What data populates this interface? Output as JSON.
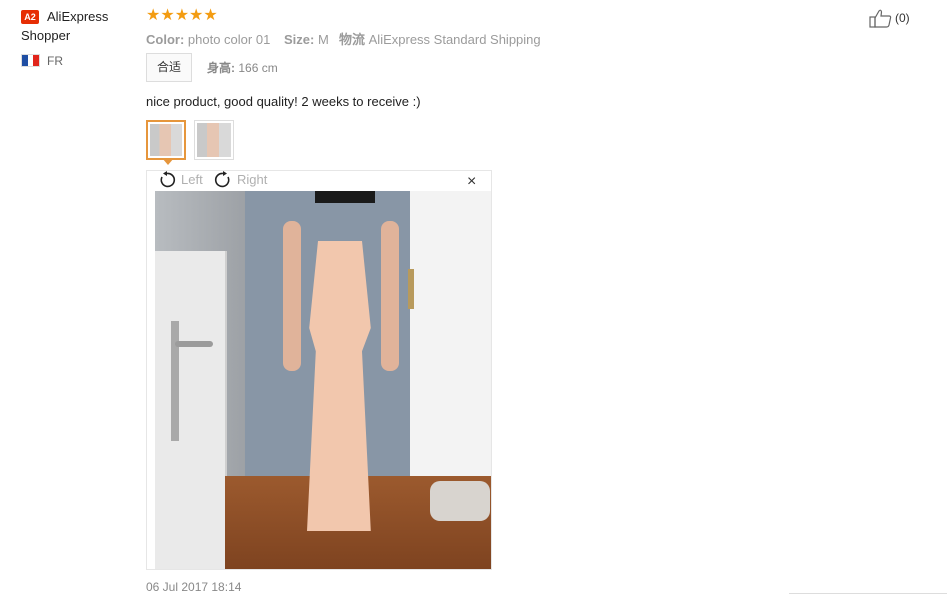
{
  "review": {
    "badge": "A2",
    "username_line1": "AliExpress",
    "username_line2": "Shopper",
    "country_code": "FR",
    "flag_colors": [
      "#1f4ea3",
      "#ffffff",
      "#e1251b"
    ],
    "rating_stars": 5,
    "stars_text": "★★★★★",
    "attributes": {
      "color_label": "Color:",
      "color_value": "photo color 01",
      "size_label": "Size:",
      "size_value": "M",
      "shipping_label": "物流",
      "shipping_value": "AliExpress Standard Shipping"
    },
    "fit_tag": "合适",
    "height_label": "身高:",
    "height_value": "166 cm",
    "feedback_text": "nice product, good quality! 2 weeks to receive :)",
    "thumbnail_count": 2,
    "viewer": {
      "rotate_left": "Left",
      "rotate_right": "Right",
      "close": "×"
    },
    "date": "06 Jul 2017 18:14",
    "helpful_count": "(0)"
  },
  "colors": {
    "star": "#f39c12",
    "badge": "#e62e04",
    "thumb_active_border": "#e6963c"
  }
}
